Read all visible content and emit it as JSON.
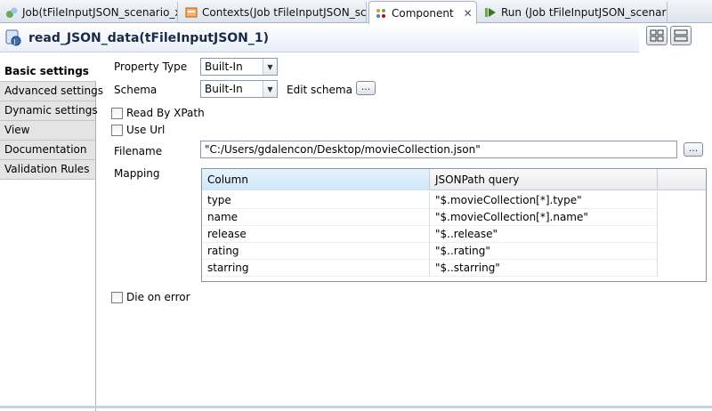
{
  "tabs": [
    {
      "label": "Job(tFileInputJSON_scenario_xpat",
      "icon": "job-icon"
    },
    {
      "label": "Contexts(Job tFileInputJSON_scen",
      "icon": "contexts-icon"
    },
    {
      "label": "Component",
      "icon": "component-icon",
      "close": "✕"
    },
    {
      "label": "Run (Job tFileInputJSON_scenario_",
      "icon": "run-icon"
    }
  ],
  "header": {
    "title": "read_JSON_data(tFileInputJSON_1)"
  },
  "sidebar": {
    "items": [
      {
        "label": "Basic settings"
      },
      {
        "label": "Advanced settings"
      },
      {
        "label": "Dynamic settings"
      },
      {
        "label": "View"
      },
      {
        "label": "Documentation"
      },
      {
        "label": "Validation Rules"
      }
    ]
  },
  "form": {
    "property_type_label": "Property Type",
    "property_type_value": "Built-In",
    "schema_label": "Schema",
    "schema_value": "Built-In",
    "edit_schema_label": "Edit schema",
    "dots": "...",
    "read_by_xpath_label": "Read By XPath",
    "use_url_label": "Use Url",
    "filename_label": "Filename",
    "filename_value": "\"C:/Users/gdalencon/Desktop/movieCollection.json\"",
    "mapping_label": "Mapping",
    "die_on_error_label": "Die on error"
  },
  "mapping": {
    "headers": [
      "Column",
      "JSONPath query"
    ],
    "rows": [
      {
        "column": "type",
        "query": "\"$.movieCollection[*].type\""
      },
      {
        "column": "name",
        "query": "\"$.movieCollection[*].name\""
      },
      {
        "column": "release",
        "query": "\"$..release\""
      },
      {
        "column": "rating",
        "query": "\"$..rating\""
      },
      {
        "column": "starring",
        "query": "\"$..starring\""
      }
    ]
  }
}
